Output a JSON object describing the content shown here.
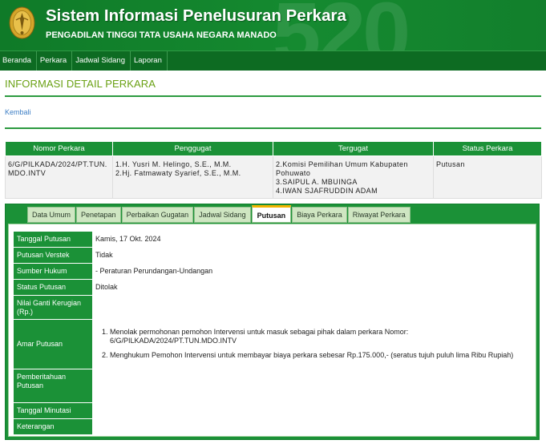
{
  "header": {
    "title": "Sistem Informasi Penelusuran Perkara",
    "subtitle": "PENGADILAN TINGGI TATA USAHA NEGARA MANADO",
    "watermark": "520",
    "color": "#158a30"
  },
  "nav": {
    "items": [
      "Beranda",
      "Perkara",
      "Jadwal Sidang",
      "Laporan"
    ]
  },
  "page": {
    "heading": "INFORMASI DETAIL PERKARA",
    "back_link": "Kembali"
  },
  "summary": {
    "headers": [
      "Nomor Perkara",
      "Penggugat",
      "Tergugat",
      "Status Perkara"
    ],
    "nomor": [
      "6/G/PILKADA/2024/PT.TUN.",
      "MDO.INTV"
    ],
    "penggugat": [
      "1.H. Yusri M. Helingo, S.E., M.M.",
      "2.Hj. Fatmawaty Syarief, S.E., M.M."
    ],
    "tergugat": [
      "2.Komisi Pemilihan Umum Kabupaten",
      "Pohuwato",
      "3.SAIPUL A. MBUINGA",
      "4.IWAN SJAFRUDDIN ADAM"
    ],
    "status": "Putusan"
  },
  "tabs": [
    "Data Umum",
    "Penetapan",
    "Perbaikan Gugatan",
    "Jadwal Sidang",
    "Putusan",
    "Biaya Perkara",
    "Riwayat Perkara"
  ],
  "active_tab": "Putusan",
  "putusan": {
    "labels": {
      "tanggal": "Tanggal Putusan",
      "verstek": "Putusan Verstek",
      "sumber": "Sumber Hukum",
      "status": "Status Putusan",
      "nilai": "Nilai Ganti Kerugian (Rp.)",
      "amar": "Amar Putusan",
      "pemberitahuan": "Pemberitahuan Putusan",
      "minutasi": "Tanggal Minutasi",
      "keterangan": "Keterangan"
    },
    "values": {
      "tanggal": "Kamis, 17 Okt. 2024",
      "verstek": "Tidak",
      "sumber": "- Peraturan Perundangan-Undangan",
      "status": "Ditolak"
    },
    "amar": [
      "Menolak permohonan pemohon Intervensi untuk masuk sebagai pihak dalam perkara Nomor: 6/G/PILKADA/2024/PT.TUN.MDO.INTV",
      "Menghukum Pemohon Intervensi  untuk membayar biaya perkara sebesar Rp.175.000,- (seratus tujuh puluh lima Ribu Rupiah)"
    ]
  }
}
